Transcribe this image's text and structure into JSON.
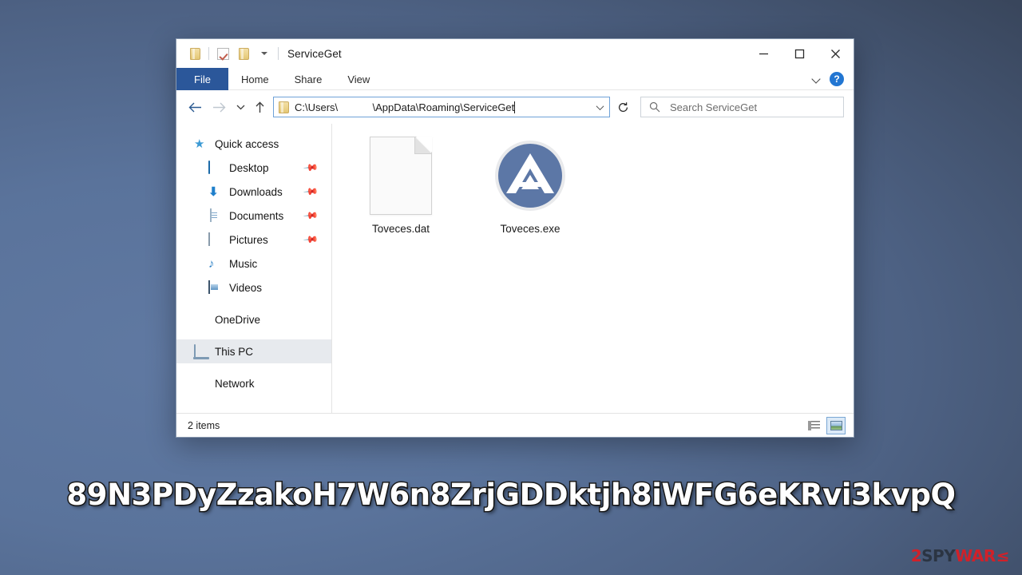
{
  "desktop": {
    "background_top_left": "#5a739b",
    "background_bottom_right": "#2b3644"
  },
  "window": {
    "title": "ServiceGet",
    "quick_access_toolbar": [
      {
        "name": "folder-icon",
        "label": ""
      },
      {
        "name": "properties-icon",
        "label": ""
      },
      {
        "name": "new-folder-icon",
        "label": ""
      },
      {
        "name": "customize-dropdown-icon",
        "label": ""
      }
    ],
    "controls": {
      "minimize": "–",
      "maximize": "□",
      "close": "×"
    }
  },
  "ribbon": {
    "tabs": [
      {
        "label": "File",
        "active": true
      },
      {
        "label": "Home",
        "active": false
      },
      {
        "label": "Share",
        "active": false
      },
      {
        "label": "View",
        "active": false
      }
    ],
    "collapse_label": "",
    "help_label": "?"
  },
  "navbar": {
    "back_label": "←",
    "forward_label": "→",
    "recent_label": "⌄",
    "up_label": "↑",
    "address": {
      "prefix": "C:\\Users\\",
      "username": "            ",
      "suffix": "\\AppData\\Roaming\\ServiceGet",
      "full_value": "C:\\Users\\            \\AppData\\Roaming\\ServiceGet"
    },
    "refresh_label": "↻",
    "search": {
      "placeholder": "Search ServiceGet",
      "value": ""
    }
  },
  "navpane": {
    "groups": [
      {
        "items": [
          {
            "label": "Quick access",
            "icon": "star-icon",
            "indent": false,
            "pinned": false,
            "selected": false
          },
          {
            "label": "Desktop",
            "icon": "desktop-icon",
            "indent": true,
            "pinned": true,
            "selected": false
          },
          {
            "label": "Downloads",
            "icon": "downloads-icon",
            "indent": true,
            "pinned": true,
            "selected": false
          },
          {
            "label": "Documents",
            "icon": "documents-icon",
            "indent": true,
            "pinned": true,
            "selected": false
          },
          {
            "label": "Pictures",
            "icon": "pictures-icon",
            "indent": true,
            "pinned": true,
            "selected": false
          },
          {
            "label": "Music",
            "icon": "music-icon",
            "indent": true,
            "pinned": false,
            "selected": false
          },
          {
            "label": "Videos",
            "icon": "videos-icon",
            "indent": true,
            "pinned": false,
            "selected": false
          }
        ]
      },
      {
        "items": [
          {
            "label": "OneDrive",
            "icon": "onedrive-icon",
            "indent": false,
            "pinned": false,
            "selected": false
          }
        ]
      },
      {
        "items": [
          {
            "label": "This PC",
            "icon": "this-pc-icon",
            "indent": false,
            "pinned": false,
            "selected": true
          }
        ]
      },
      {
        "items": [
          {
            "label": "Network",
            "icon": "network-icon",
            "indent": false,
            "pinned": false,
            "selected": false
          }
        ]
      }
    ],
    "pin_glyph": "📌"
  },
  "files": [
    {
      "name": "Toveces.dat",
      "icon": "blank-document-icon",
      "selected": false
    },
    {
      "name": "Toveces.exe",
      "icon": "autoit-application-icon",
      "selected": false
    }
  ],
  "autoit_icon": {
    "circle_color": "#5c77a6",
    "glyph_color": "#ffffff"
  },
  "statusbar": {
    "item_count": "2 items",
    "views": [
      {
        "name": "details-view-button",
        "active": false
      },
      {
        "name": "large-icons-view-button",
        "active": true
      }
    ]
  },
  "overlay": {
    "ransom_id": "89N3PDyZzakoH7W6n8ZrjGDDktjh8iWFG6eKRvi3kvpQ"
  },
  "watermark": {
    "part1": "2",
    "part2": "SPY",
    "part3": "WAR",
    "part4": "≤",
    "color_red": "#d81f26",
    "color_dark": "#2a3340"
  }
}
